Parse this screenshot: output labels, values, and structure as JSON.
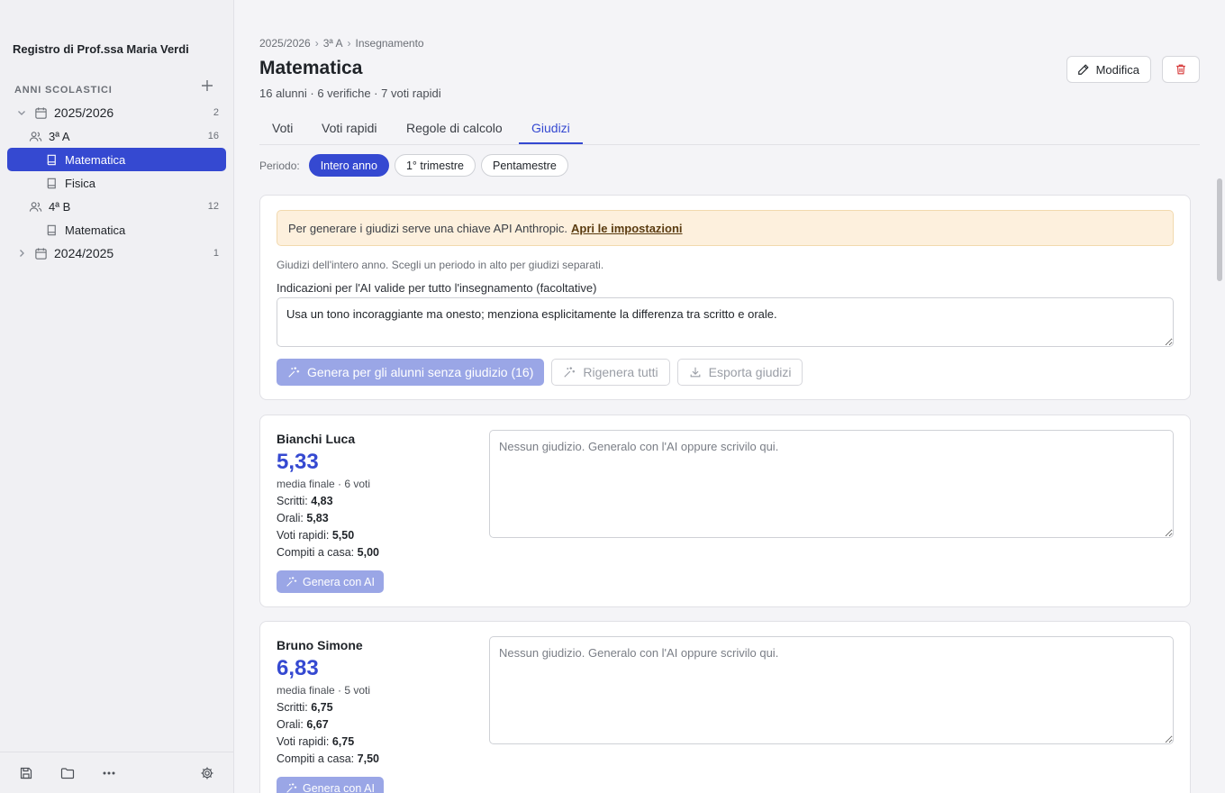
{
  "app": {
    "title": "Registro di Prof.ssa Maria Verdi"
  },
  "sidebar": {
    "section_label": "ANNI SCOLASTICI",
    "tree": [
      {
        "type": "year",
        "label": "2025/2026",
        "count": "2",
        "expanded": true
      },
      {
        "type": "class",
        "label": "3ª A",
        "count": "16"
      },
      {
        "type": "subject",
        "label": "Matematica",
        "active": true
      },
      {
        "type": "subject",
        "label": "Fisica"
      },
      {
        "type": "class",
        "label": "4ª B",
        "count": "12"
      },
      {
        "type": "subject",
        "label": "Matematica"
      },
      {
        "type": "year",
        "label": "2024/2025",
        "count": "1",
        "expanded": false
      }
    ]
  },
  "breadcrumb": [
    "2025/2026",
    "3ª A",
    "Insegnamento"
  ],
  "header": {
    "title": "Matematica",
    "subtitle": "16 alunni · 6 verifiche · 7 voti rapidi",
    "edit_label": "Modifica"
  },
  "tabs": [
    {
      "label": "Voti",
      "active": false
    },
    {
      "label": "Voti rapidi",
      "active": false
    },
    {
      "label": "Regole di calcolo",
      "active": false
    },
    {
      "label": "Giudizi",
      "active": true
    }
  ],
  "period": {
    "label": "Periodo:",
    "options": [
      {
        "label": "Intero anno",
        "active": true
      },
      {
        "label": "1° trimestre",
        "active": false
      },
      {
        "label": "Pentamestre",
        "active": false
      }
    ]
  },
  "ai_panel": {
    "alert_text": "Per generare i giudizi serve una chiave API Anthropic.",
    "alert_link": "Apri le impostazioni",
    "note": "Giudizi dell'intero anno. Scegli un periodo in alto per giudizi separati.",
    "field_label": "Indicazioni per l'AI valide per tutto l'insegnamento (facoltative)",
    "field_value": "Usa un tono incoraggiante ma onesto; menziona esplicitamente la differenza tra scritto e orale.",
    "generate_label": "Genera per gli alunni senza giudizio (16)",
    "regenerate_label": "Rigenera tutti",
    "export_label": "Esporta giudizi"
  },
  "students": [
    {
      "name": "Bianchi Luca",
      "average": "5,33",
      "meta": "media finale · 6 voti",
      "lines": [
        {
          "label": "Scritti:",
          "value": "4,83"
        },
        {
          "label": "Orali:",
          "value": "5,83"
        },
        {
          "label": "Voti rapidi:",
          "value": "5,50"
        },
        {
          "label": "Compiti a casa:",
          "value": "5,00"
        }
      ],
      "ai_button": "Genera con AI",
      "placeholder": "Nessun giudizio. Generalo con l'AI oppure scrivilo qui."
    },
    {
      "name": "Bruno Simone",
      "average": "6,83",
      "meta": "media finale · 5 voti",
      "lines": [
        {
          "label": "Scritti:",
          "value": "6,75"
        },
        {
          "label": "Orali:",
          "value": "6,67"
        },
        {
          "label": "Voti rapidi:",
          "value": "6,75"
        },
        {
          "label": "Compiti a casa:",
          "value": "7,50"
        }
      ],
      "ai_button": "Genera con AI",
      "placeholder": "Nessun giudizio. Generalo con l'AI oppure scrivilo qui."
    }
  ],
  "colors": {
    "accent": "#3549d1",
    "accent_muted": "#9aa6e6",
    "danger": "#d63a3a",
    "alert_bg": "#fdf0dd"
  },
  "icons": [
    "plus-icon",
    "chevron-down-icon",
    "chevron-right-icon",
    "calendar-icon",
    "users-icon",
    "book-icon",
    "pencil-icon",
    "trash-icon",
    "sparkles-icon",
    "download-icon",
    "save-icon",
    "folder-icon",
    "more-icon",
    "gear-icon"
  ]
}
